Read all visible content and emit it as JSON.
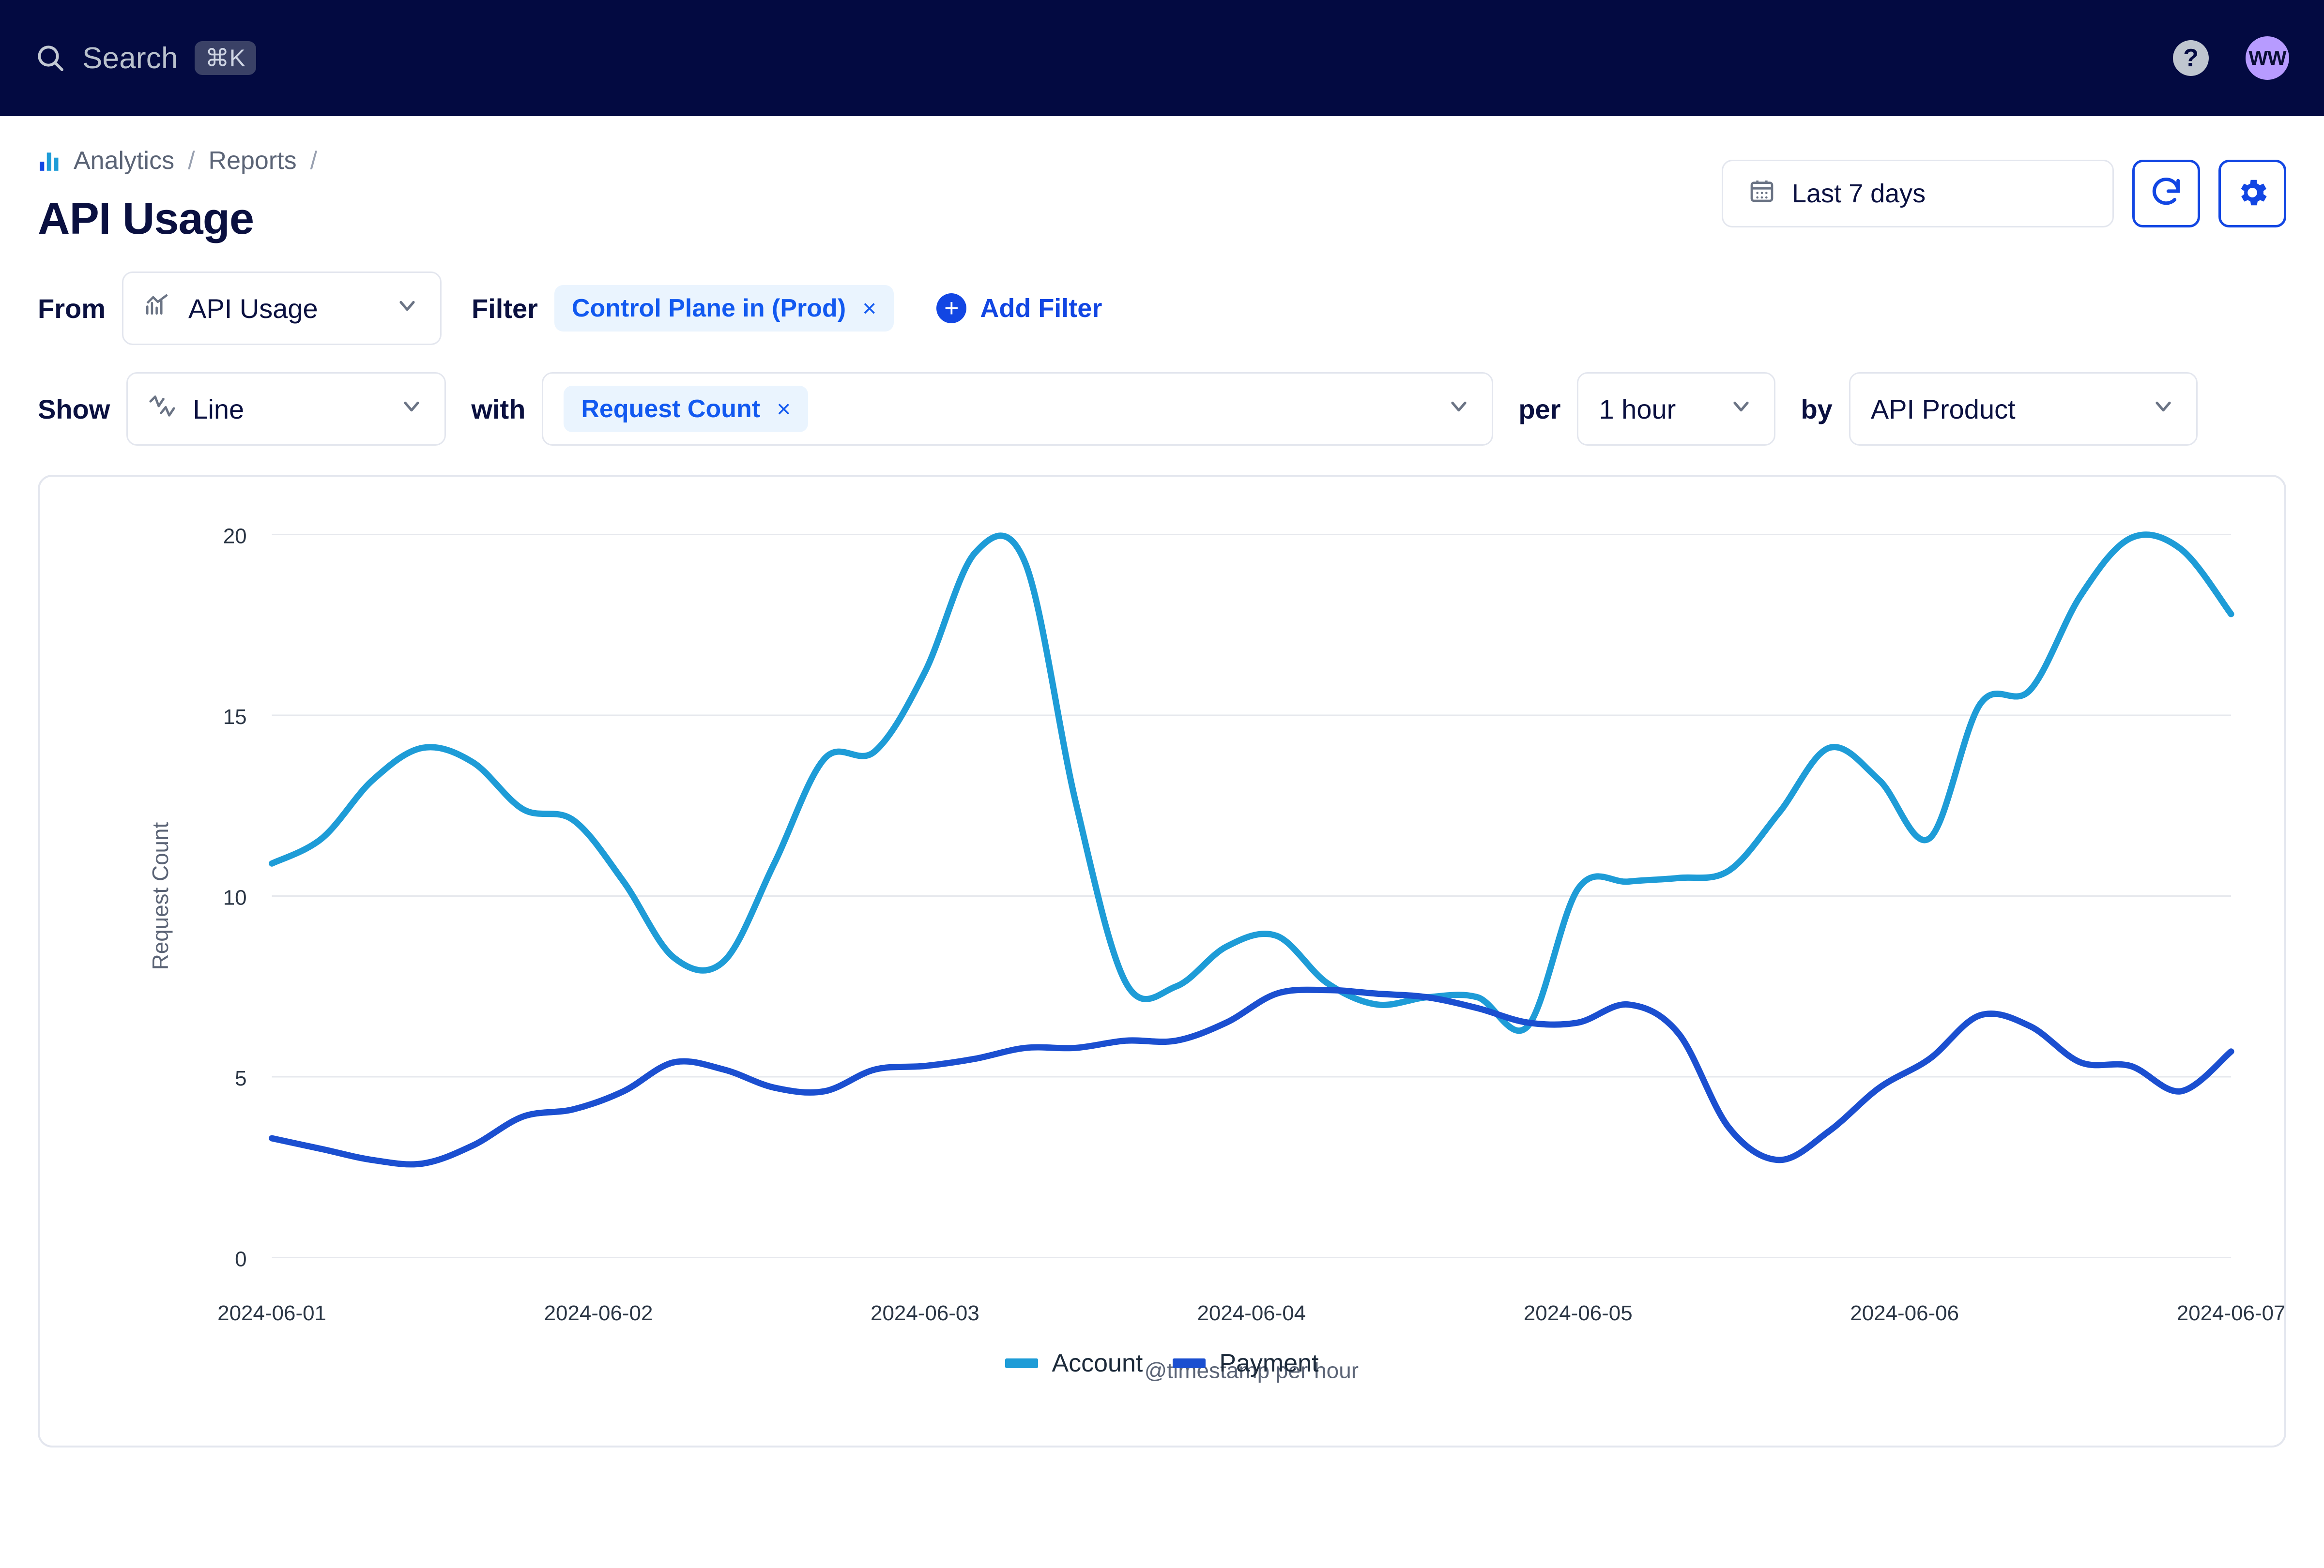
{
  "topnav": {
    "search_label": "Search",
    "search_icon": "search-icon",
    "shortcut": "⌘K",
    "help_icon": "question-mark-icon",
    "avatar_initials": "WW"
  },
  "breadcrumb": {
    "icon": "bar-chart-icon",
    "items": [
      "Analytics",
      "Reports"
    ],
    "separator": "/"
  },
  "header": {
    "title": "API Usage",
    "date_range": "Last 7 days",
    "calendar_icon": "calendar-icon",
    "refresh_icon": "refresh-icon",
    "settings_icon": "gear-icon"
  },
  "query": {
    "from_label": "From",
    "from_value": "API Usage",
    "from_icon": "chart-line-icon",
    "filter_label": "Filter",
    "filter_chips": [
      {
        "label": "Control Plane in (Prod)",
        "remove": "×"
      }
    ],
    "add_filter_label": "Add Filter",
    "show_label": "Show",
    "show_value": "Line",
    "show_icon": "line-chart-icon",
    "with_label": "with",
    "metric_chips": [
      {
        "label": "Request Count",
        "remove": "×"
      }
    ],
    "per_label": "per",
    "per_value": "1 hour",
    "by_label": "by",
    "by_value": "API Product"
  },
  "colors": {
    "nav_bg": "#030A41",
    "accent_blue": "#1246E3",
    "chip_blue": "#1259F0",
    "series_account": "#1E9CD7",
    "series_payment": "#1B4FD0",
    "avatar_bg": "#B79BFF"
  },
  "chart_data": {
    "type": "line",
    "title": "",
    "xlabel": "@timestamp per hour",
    "ylabel": "Request Count",
    "ylim": [
      0,
      20
    ],
    "yticks": [
      0,
      5,
      10,
      15,
      20
    ],
    "xticks": [
      "2024-06-01",
      "2024-06-02",
      "2024-06-03",
      "2024-06-04",
      "2024-06-05",
      "2024-06-06",
      "2024-06-07"
    ],
    "grid": true,
    "legend_position": "bottom",
    "x": [
      0,
      1,
      2,
      3,
      4,
      5,
      6,
      7,
      8,
      9,
      10,
      11,
      12,
      13,
      14,
      15,
      16,
      17,
      18,
      19,
      20,
      21,
      22,
      23,
      24,
      25,
      26,
      27,
      28,
      29,
      30,
      31,
      32,
      33,
      34,
      35
    ],
    "series": [
      {
        "name": "Account",
        "color": "#1E9CD7",
        "values": [
          10.9,
          11.6,
          13.2,
          14.1,
          13.7,
          12.4,
          12.1,
          10.4,
          8.3,
          8.2,
          10.9,
          13.8,
          14.0,
          16.2,
          19.5,
          19.2,
          12.6,
          7.6,
          7.5,
          8.6,
          8.9,
          7.6,
          7.0,
          7.2,
          7.2,
          6.4,
          10.2,
          10.4,
          10.5,
          10.7,
          12.3,
          14.1,
          13.2,
          11.6,
          15.3,
          15.7,
          18.3,
          19.9,
          19.6,
          17.8
        ]
      },
      {
        "name": "Payment",
        "color": "#1B4FD0",
        "values": [
          3.3,
          3.0,
          2.7,
          2.6,
          3.1,
          3.9,
          4.1,
          4.6,
          5.4,
          5.2,
          4.7,
          4.6,
          5.2,
          5.3,
          5.5,
          5.8,
          5.8,
          6.0,
          6.0,
          6.5,
          7.3,
          7.4,
          7.3,
          7.2,
          6.9,
          6.5,
          6.5,
          7.0,
          6.2,
          3.6,
          2.7,
          3.5,
          4.7,
          5.5,
          6.7,
          6.4,
          5.4,
          5.3,
          4.6,
          5.7
        ]
      }
    ]
  }
}
